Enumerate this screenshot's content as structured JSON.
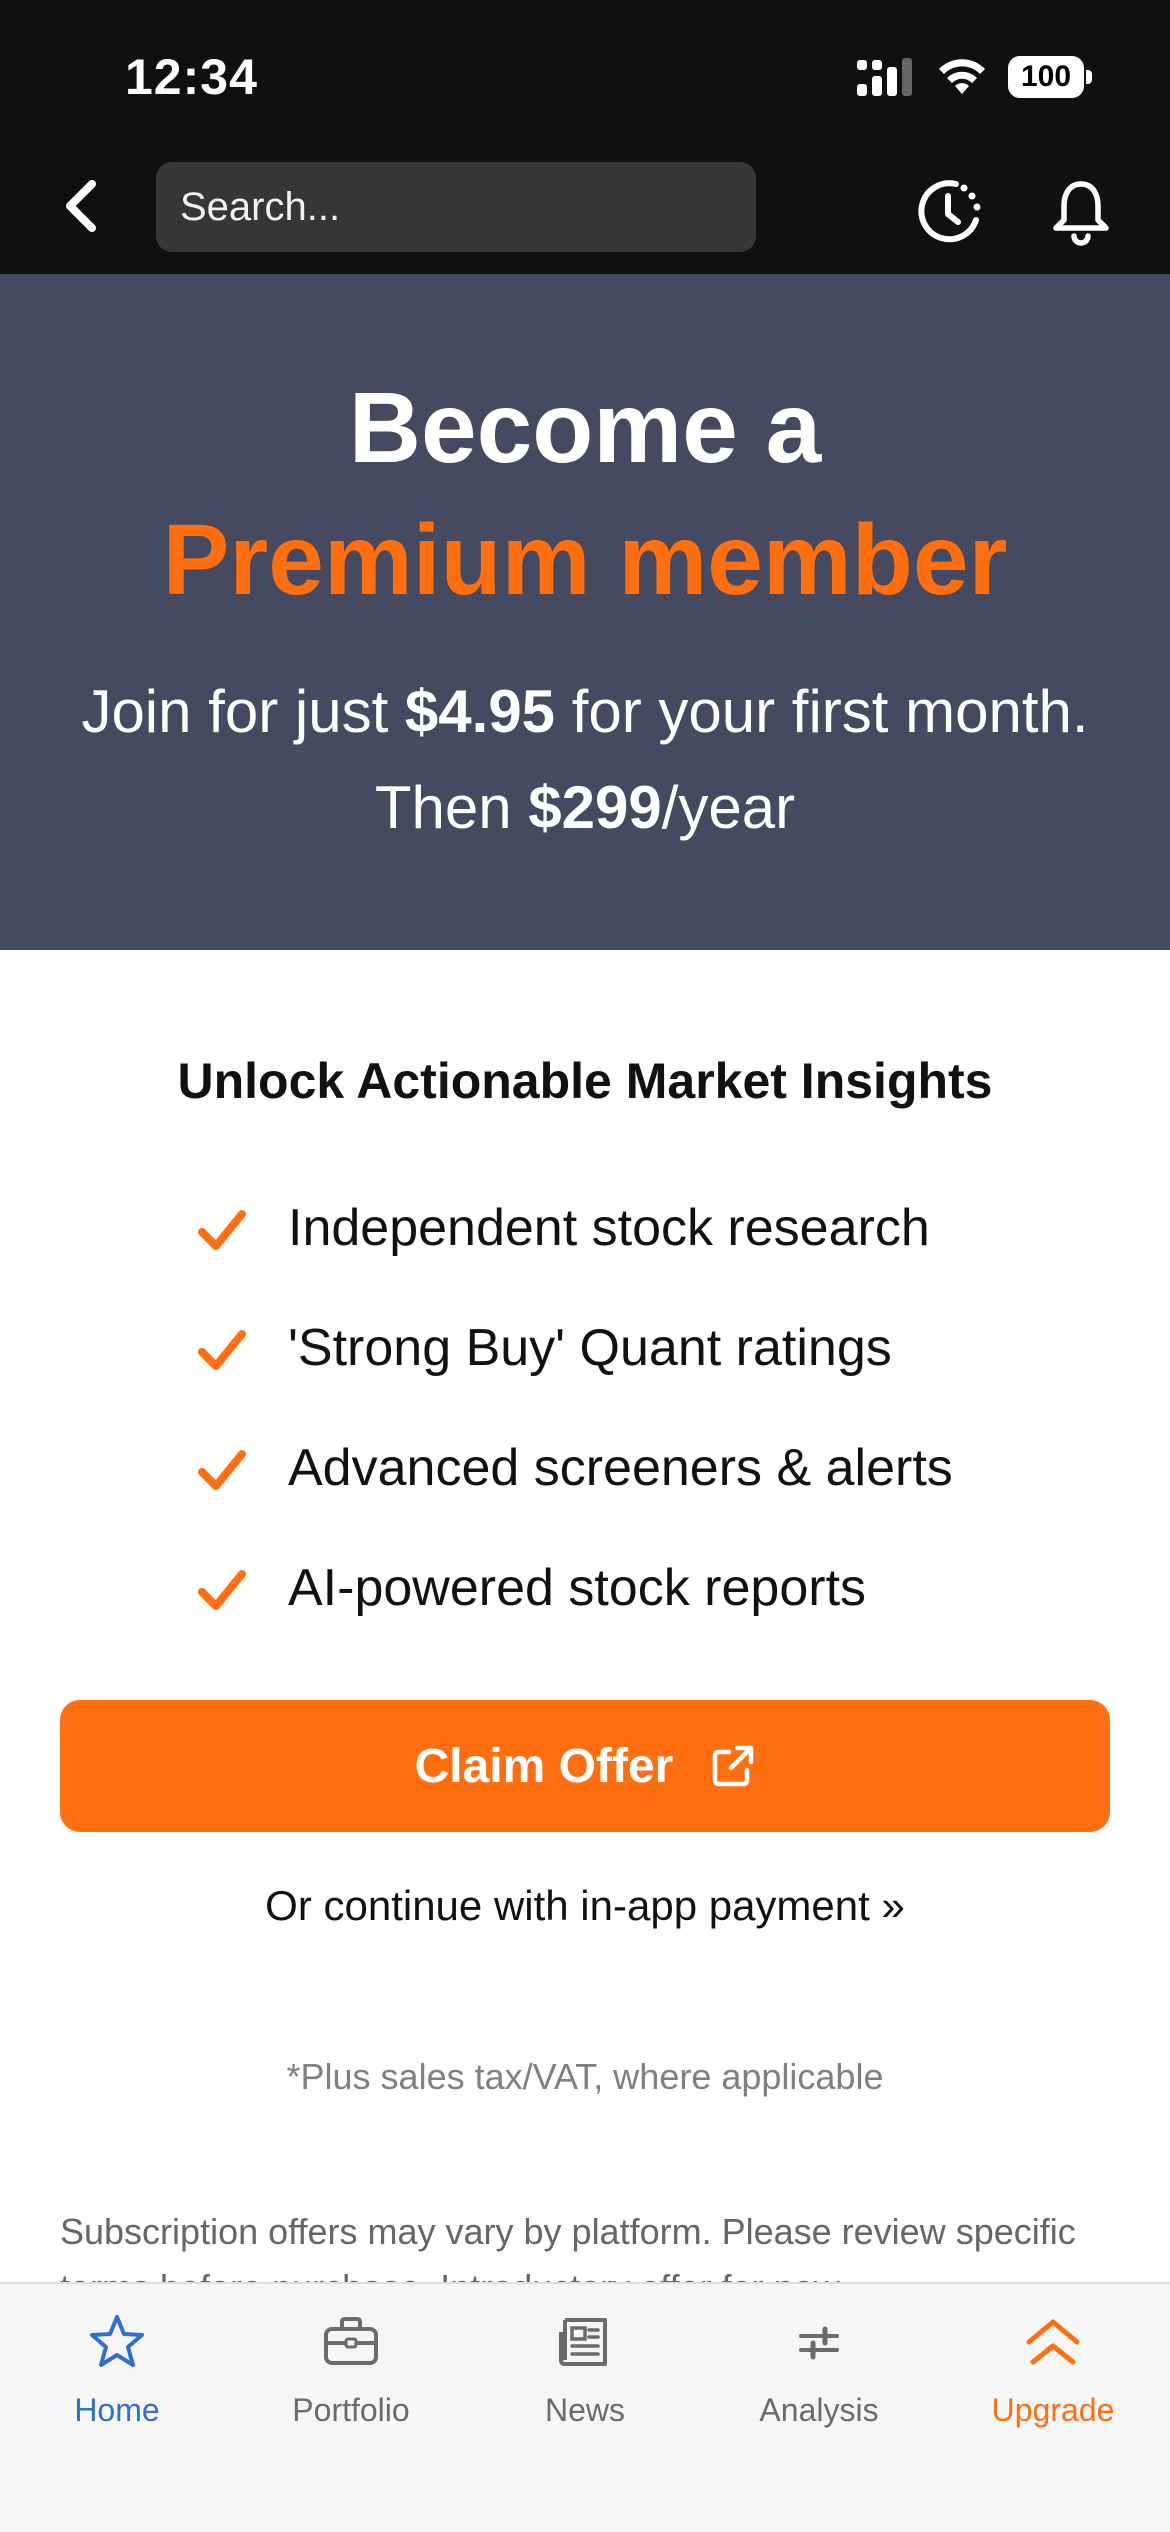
{
  "status_bar": {
    "time": "12:34",
    "battery": "100"
  },
  "header": {
    "search_placeholder": "Search...",
    "icons": [
      "chevron-left-icon",
      "market-clock-icon",
      "bell-icon"
    ]
  },
  "hero": {
    "title_line1": "Become a",
    "title_line2": "Premium member",
    "sub_prefix": "Join for just ",
    "sub_price1": "$4.95",
    "sub_mid": " for your first month. Then ",
    "sub_price2": "$299",
    "sub_suffix": "/year"
  },
  "insights": {
    "title": "Unlock Actionable Market Insights",
    "features": [
      "Independent stock research",
      "'Strong Buy' Quant ratings",
      "Advanced screeners & alerts",
      "AI-powered stock reports"
    ]
  },
  "cta": {
    "claim_label": "Claim Offer",
    "iap_link": "Or continue with in-app payment »",
    "tax_note": "*Plus sales tax/VAT, where applicable",
    "disclaimer": "Subscription offers may vary by platform. Please review specific terms before purchase. Introductory offer for new"
  },
  "tab_bar": {
    "tabs": [
      {
        "label": "Home",
        "icon": "star-icon",
        "active": true
      },
      {
        "label": "Portfolio",
        "icon": "briefcase-icon"
      },
      {
        "label": "News",
        "icon": "newspaper-icon"
      },
      {
        "label": "Analysis",
        "icon": "sliders-icon"
      },
      {
        "label": "Upgrade",
        "icon": "double-chevron-up-icon"
      }
    ]
  },
  "colors": {
    "accent": "#ff6f0f",
    "hero_bg": "#454a61",
    "active_tab": "#2f6ed3",
    "header_bg": "#101010"
  }
}
